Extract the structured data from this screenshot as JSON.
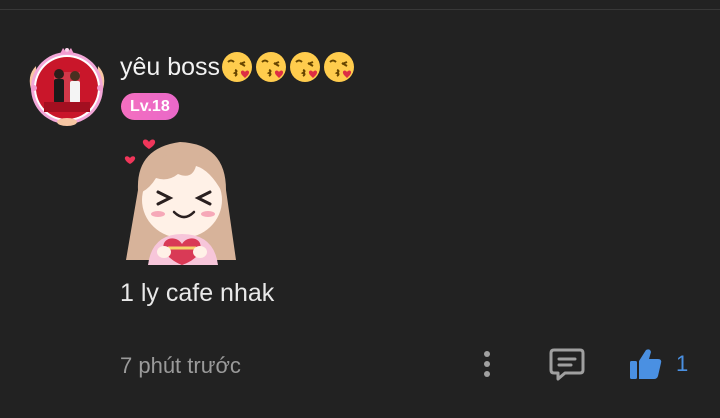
{
  "comment": {
    "username": "yêu boss",
    "username_emojis": [
      "kissing-heart-emoji",
      "kissing-heart-emoji",
      "kissing-heart-emoji",
      "kissing-heart-emoji"
    ],
    "level": "Lv.18",
    "sticker": "chibi-girl-heart-sticker",
    "text": "1 ly cafe nhak",
    "timestamp": "7 phút trước",
    "like_count": "1"
  },
  "icons": {
    "more": "more-vertical-icon",
    "reply": "comment-reply-icon",
    "like": "thumbs-up-icon"
  },
  "colors": {
    "background": "#222222",
    "level_badge": "#f46fbf",
    "like_accent": "#4a90e2",
    "muted_text": "#9a9a9a"
  }
}
